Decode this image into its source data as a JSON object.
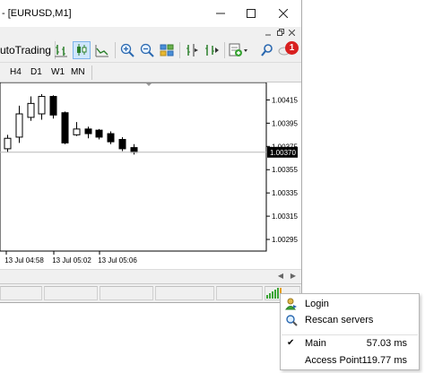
{
  "window": {
    "title": "- [EURUSD,M1]"
  },
  "toolbar": {
    "autotrading_label": "utoTrading",
    "notification_count": "1"
  },
  "timeframes": [
    "H4",
    "D1",
    "W1",
    "MN"
  ],
  "chart_data": {
    "type": "candlestick",
    "symbol": "EURUSD",
    "timeframe": "M1",
    "y_ticks": [
      "1.00415",
      "1.00395",
      "1.00375",
      "1.00355",
      "1.00335",
      "1.00315",
      "1.00295"
    ],
    "ylim": [
      1.00285,
      1.0043
    ],
    "current_price": "1.00370",
    "x_ticks": [
      "13 Jul 04:58",
      "13 Jul 05:02",
      "13 Jul 05:06"
    ],
    "candles": [
      {
        "open": 1.00373,
        "close": 1.00382,
        "high": 1.00385,
        "low": 1.0037
      },
      {
        "open": 1.00383,
        "close": 1.00403,
        "high": 1.0041,
        "low": 1.00378
      },
      {
        "open": 1.004,
        "close": 1.00412,
        "high": 1.00418,
        "low": 1.00397
      },
      {
        "open": 1.00403,
        "close": 1.00418,
        "high": 1.0042,
        "low": 1.00398
      },
      {
        "open": 1.00418,
        "close": 1.00402,
        "high": 1.00419,
        "low": 1.00399
      },
      {
        "open": 1.00404,
        "close": 1.00378,
        "high": 1.00405,
        "low": 1.00377
      },
      {
        "open": 1.00385,
        "close": 1.0039,
        "high": 1.00396,
        "low": 1.00384
      },
      {
        "open": 1.0039,
        "close": 1.00386,
        "high": 1.00392,
        "low": 1.00382
      },
      {
        "open": 1.00389,
        "close": 1.00383,
        "high": 1.0039,
        "low": 1.00381
      },
      {
        "open": 1.00386,
        "close": 1.00379,
        "high": 1.00388,
        "low": 1.00377
      },
      {
        "open": 1.00381,
        "close": 1.00373,
        "high": 1.00383,
        "low": 1.00371
      },
      {
        "open": 1.00374,
        "close": 1.0037,
        "high": 1.00377,
        "low": 1.00368
      }
    ]
  },
  "popup": {
    "login_label": "Login",
    "rescan_label": "Rescan servers",
    "servers": [
      {
        "name": "Main",
        "ping": "57.03 ms",
        "checked": true
      },
      {
        "name": "Access Point",
        "ping": "119.77 ms",
        "checked": false
      }
    ]
  },
  "colors": {
    "accent": "#7eb4ea",
    "badge": "#d8201f",
    "connection_bars": "#3aa435"
  }
}
